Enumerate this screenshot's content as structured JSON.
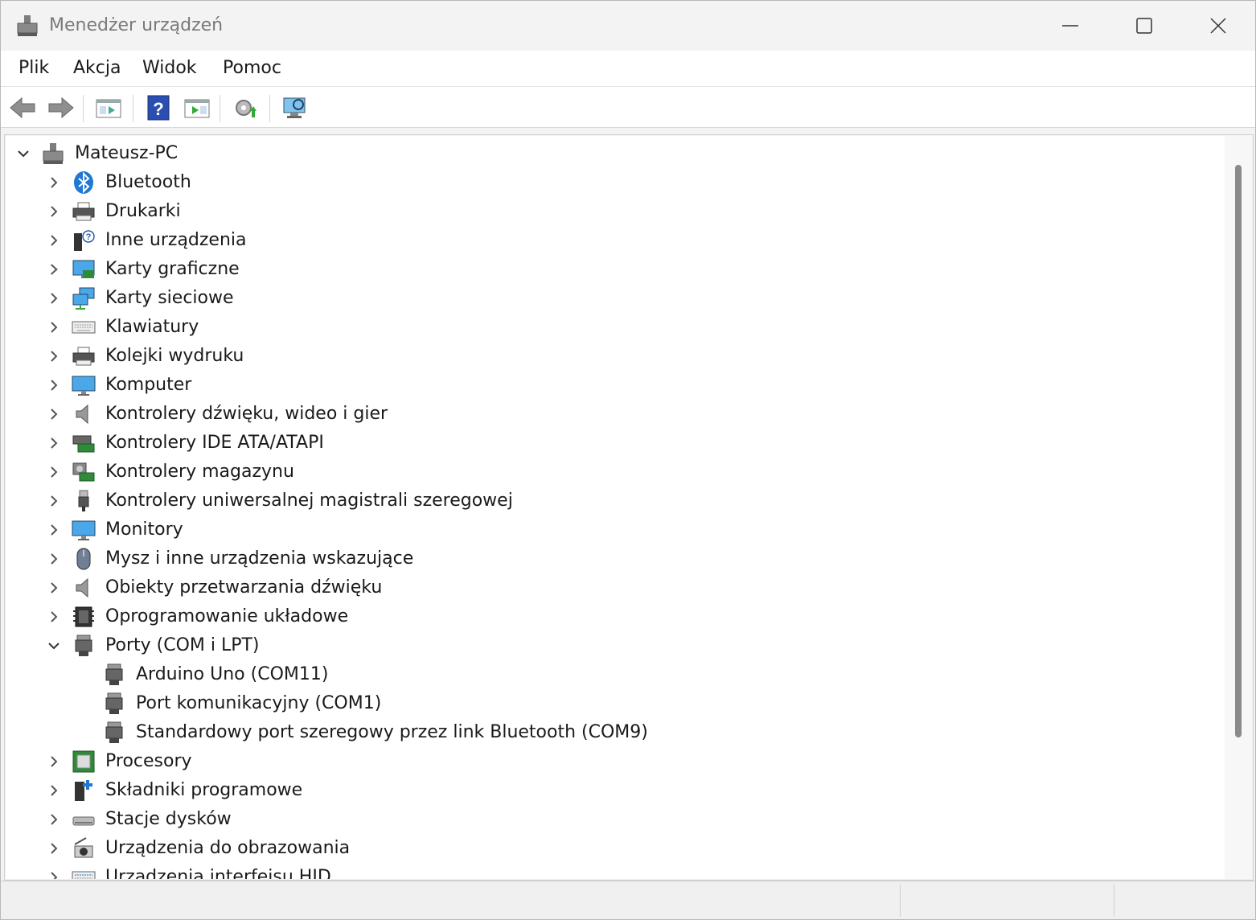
{
  "window": {
    "title": "Menedżer urządzeń"
  },
  "menu": [
    "Plik",
    "Akcja",
    "Widok",
    "Pomoc"
  ],
  "toolbar": {
    "buttons": [
      "back-arrow-icon",
      "forward-arrow-icon",
      "properties-icon",
      "help-icon",
      "update-driver-icon",
      "scan-hardware-icon",
      "monitor-scan-icon"
    ]
  },
  "tree": {
    "root": {
      "label": "Mateusz-PC",
      "expanded": true
    },
    "categories": [
      {
        "label": "Bluetooth",
        "icon": "bluetooth-icon"
      },
      {
        "label": "Drukarki",
        "icon": "printer-icon"
      },
      {
        "label": "Inne urządzenia",
        "icon": "unknown-device-icon"
      },
      {
        "label": "Karty graficzne",
        "icon": "display-adapter-icon"
      },
      {
        "label": "Karty sieciowe",
        "icon": "network-adapter-icon"
      },
      {
        "label": "Klawiatury",
        "icon": "keyboard-icon"
      },
      {
        "label": "Kolejki wydruku",
        "icon": "print-queue-icon"
      },
      {
        "label": "Komputer",
        "icon": "computer-icon"
      },
      {
        "label": "Kontrolery dźwięku, wideo i gier",
        "icon": "speaker-icon"
      },
      {
        "label": "Kontrolery IDE ATA/ATAPI",
        "icon": "ide-controller-icon"
      },
      {
        "label": "Kontrolery magazynu",
        "icon": "storage-controller-icon"
      },
      {
        "label": "Kontrolery uniwersalnej magistrali szeregowej",
        "icon": "usb-icon"
      },
      {
        "label": "Monitory",
        "icon": "monitor-icon"
      },
      {
        "label": "Mysz i inne urządzenia wskazujące",
        "icon": "mouse-icon"
      },
      {
        "label": "Obiekty przetwarzania dźwięku",
        "icon": "speaker-icon"
      },
      {
        "label": "Oprogramowanie układowe",
        "icon": "firmware-chip-icon"
      },
      {
        "label": "Porty (COM i LPT)",
        "icon": "port-icon",
        "expanded": true,
        "children": [
          "Arduino Uno (COM11)",
          "Port komunikacyjny (COM1)",
          "Standardowy port szeregowy przez link Bluetooth (COM9)"
        ]
      },
      {
        "label": "Procesory",
        "icon": "processor-icon"
      },
      {
        "label": "Składniki programowe",
        "icon": "software-component-icon"
      },
      {
        "label": "Stacje dysków",
        "icon": "disk-drive-icon"
      },
      {
        "label": "Urządzenia do obrazowania",
        "icon": "camera-icon"
      },
      {
        "label": "Urządzenia interfejsu HID",
        "icon": "hid-icon"
      }
    ]
  }
}
